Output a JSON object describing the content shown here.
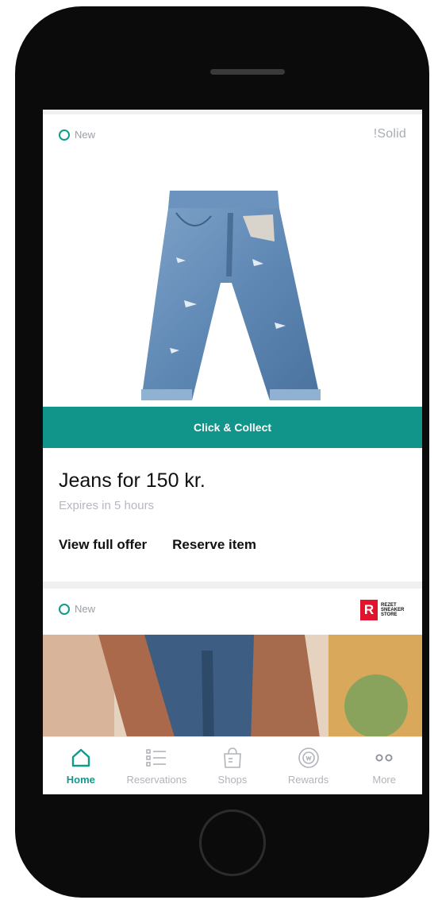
{
  "offers": [
    {
      "tag": "New",
      "brand": "!Solid",
      "banner": "Click & Collect",
      "title": "Jeans for 150 kr.",
      "expires": "Expires in 5 hours",
      "actions": [
        "View full offer",
        "Reserve item"
      ]
    },
    {
      "tag": "New",
      "brand_letter": "R",
      "brand_text": "REZET SNEAKER STORE"
    }
  ],
  "tabs": [
    {
      "label": "Home",
      "icon": "home-icon",
      "active": true
    },
    {
      "label": "Reservations",
      "icon": "list-icon",
      "active": false
    },
    {
      "label": "Shops",
      "icon": "shopping-bag-icon",
      "active": false
    },
    {
      "label": "Rewards",
      "icon": "rewards-coin-icon",
      "active": false
    },
    {
      "label": "More",
      "icon": "more-icon",
      "active": false
    }
  ],
  "colors": {
    "accent": "#119489",
    "brand_red": "#e2142d",
    "muted": "#b0b4bb"
  }
}
